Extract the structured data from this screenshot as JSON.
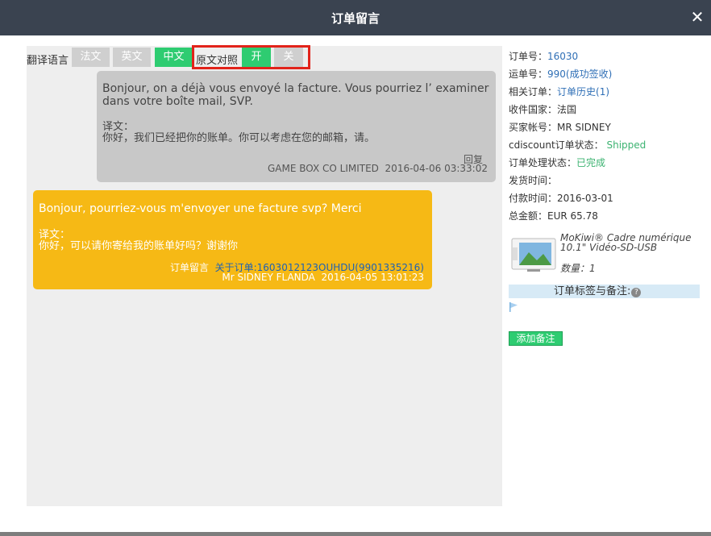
{
  "dialog": {
    "title": "订单留言",
    "close_glyph": "✕"
  },
  "translate_bar": {
    "label": "翻译语言",
    "languages": [
      "法文",
      "英文",
      "中文"
    ],
    "active_language": "中文",
    "compare_label": "原文对照",
    "on_label": "开",
    "off_label": "关",
    "compare_state": "开"
  },
  "messages": [
    {
      "original": "Bonjour, on a déjà vous envoyé la facture. Vous pourriez l’  examiner dans votre boîte mail, SVP.",
      "translation_label": "译文：",
      "translation": "你好，我们已经把你的账单。你可以考虑在您的邮箱，请。",
      "reply_label": "回复",
      "sender": "GAME BOX CO LIMITED",
      "time": "2016-04-06 03:33:02"
    },
    {
      "original": "Bonjour, pourriez-vous m'envoyer une facture svp? Merci",
      "translation_label": "译文：",
      "translation": "你好，可以请你寄给我的账单好吗？谢谢你",
      "type_label": "订单留言",
      "order_ref": "关于订单:1603012123OUHDU(9901335216)",
      "sender": "Mr SIDNEY FLANDA",
      "time": "2016-04-05 13:01:23"
    }
  ],
  "order_info": {
    "order_no_label": "订单号：",
    "order_no": "16030",
    "tracking_label": "运单号：",
    "tracking_no": "990",
    "tracking_status": "(成功签收)",
    "related_label": "相关订单：",
    "related_link": "订单历史(1)",
    "country_label": "收件国家：",
    "country": "法国",
    "buyer_label": "买家帐号：",
    "buyer": "MR SIDNEY",
    "platform_status_label": "cdiscount订单状态：",
    "platform_status": "Shipped",
    "process_status_label": "订单处理状态：",
    "process_status": "已完成",
    "ship_time_label": "发货时间：",
    "ship_time": "",
    "pay_time_label": "付款时间：",
    "pay_time": "2016-03-01",
    "total_label": "总金额：",
    "total": "EUR 65.78"
  },
  "product": {
    "name": "MoKiwi® Cadre numérique 10.1\" Vidéo-SD-USB",
    "qty_label": "数量：",
    "qty": "1"
  },
  "tags": {
    "title": "订单标签与备注:",
    "help_glyph": "?"
  },
  "add_note_label": "添加备注",
  "colors": {
    "titlebar": "#3a4350",
    "green": "#2ecc71",
    "yellow_bubble": "#f6b915",
    "grey_bubble": "#c8c8c8",
    "link": "#2f6fb6",
    "highlight_box": "#e2231a"
  }
}
